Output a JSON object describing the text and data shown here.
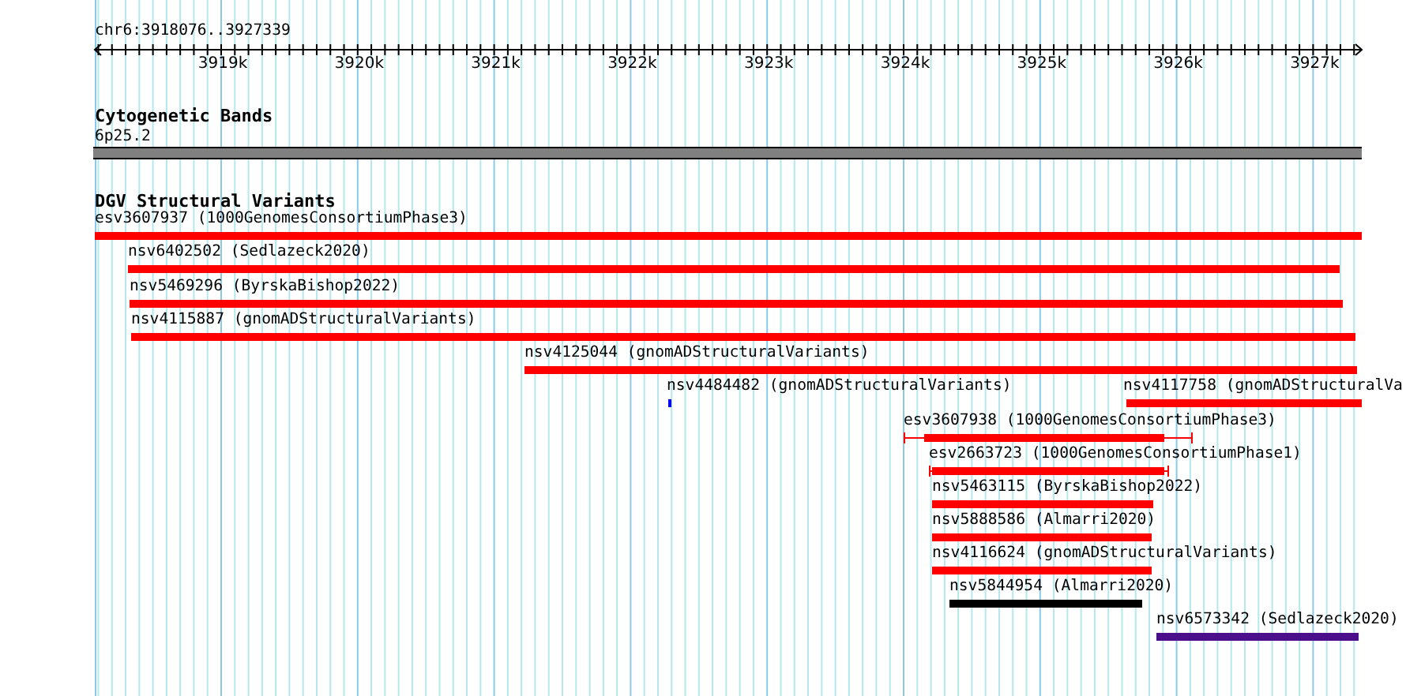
{
  "ruler": {
    "location": "chr6:3918076..3927339",
    "ticks": [
      "3919k",
      "3920k",
      "3921k",
      "3922k",
      "3923k",
      "3924k",
      "3925k",
      "3926k",
      "3927k"
    ]
  },
  "cytogenetic_bands": {
    "title": "Cytogenetic Bands",
    "band": "6p25.2"
  },
  "structural_variants": {
    "title": "DGV Structural Variants",
    "features": [
      {
        "label": "esv3607937 (1000GenomesConsortiumPhase3)",
        "color": "#ff0000",
        "kind": "bar"
      },
      {
        "label": "nsv6402502 (Sedlazeck2020)",
        "color": "#ff0000",
        "kind": "bar"
      },
      {
        "label": "nsv5469296 (ByrskaBishop2022)",
        "color": "#ff0000",
        "kind": "bar"
      },
      {
        "label": "nsv4115887 (gnomADStructuralVariants)",
        "color": "#ff0000",
        "kind": "bar"
      },
      {
        "label": "nsv4125044 (gnomADStructuralVariants)",
        "color": "#ff0000",
        "kind": "bar"
      },
      {
        "label": "nsv4484482 (gnomADStructuralVariants)",
        "color": "#0000ff",
        "kind": "bar"
      },
      {
        "label": "nsv4117758 (gnomADStructuralVa",
        "color": "#ff0000",
        "kind": "bar"
      },
      {
        "label": "esv3607938 (1000GenomesConsortiumPhase3)",
        "color": "#ff0000",
        "kind": "interval"
      },
      {
        "label": "esv2663723 (1000GenomesConsortiumPhase1)",
        "color": "#ff0000",
        "kind": "interval"
      },
      {
        "label": "nsv5463115 (ByrskaBishop2022)",
        "color": "#ff0000",
        "kind": "bar"
      },
      {
        "label": "nsv5888586 (Almarri2020)",
        "color": "#ff0000",
        "kind": "bar"
      },
      {
        "label": "nsv4116624 (gnomADStructuralVariants)",
        "color": "#ff0000",
        "kind": "bar"
      },
      {
        "label": "nsv5844954 (Almarri2020)",
        "color": "#000000",
        "kind": "bar"
      },
      {
        "label": "nsv6573342 (Sedlazeck2020)",
        "color": "#4b0f8c",
        "kind": "bar"
      }
    ]
  }
}
